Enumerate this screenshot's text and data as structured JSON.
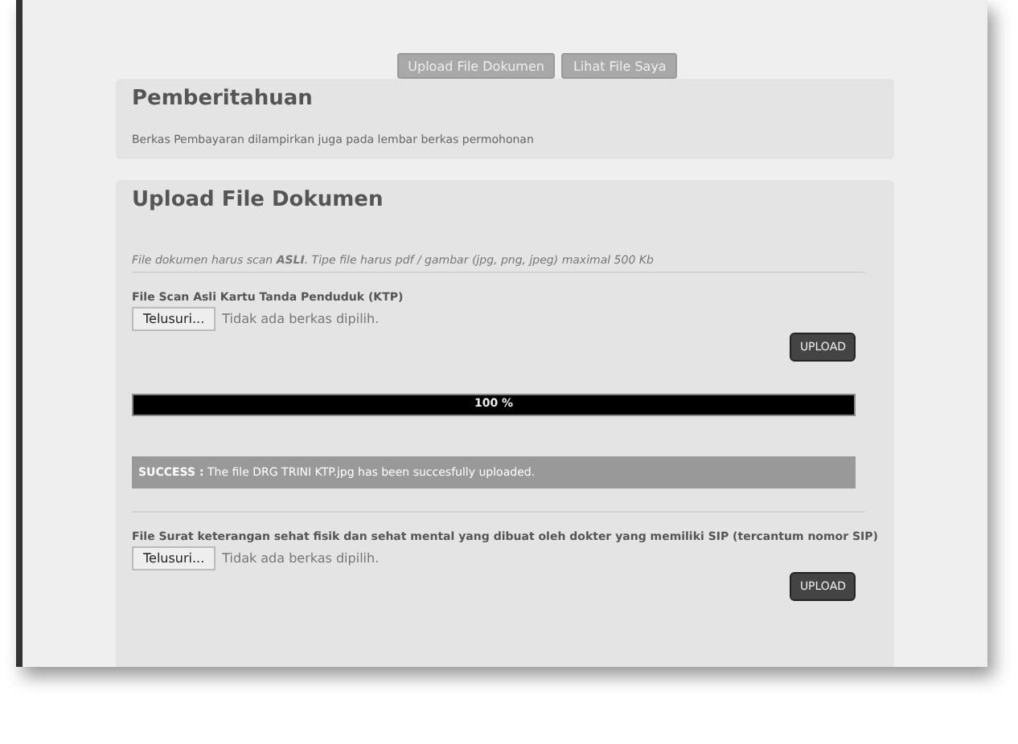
{
  "nav_buttons": [
    "Upload File Dokumen",
    "Lihat File Saya"
  ],
  "notice": {
    "title": "Pemberitahuan",
    "text": "Berkas Pembayaran dilampirkan juga pada lembar berkas permohonan"
  },
  "upload": {
    "title": "Upload File Dokumen",
    "note": "File dokumen harus scan **ASLI**. Tipe file harus pdf / gambar (jpg, png, jpeg) maximal 500 Kb",
    "fields": [
      {
        "label": "File Scan Asli Kartu Tanda Penduduk (KTP)",
        "browse": "Telusuri...",
        "file_status": "Tidak ada berkas dipilih.",
        "button": "UPLOAD",
        "progress": {
          "level": 1,
          "reading": "100 %"
        },
        "message": "**SUCCESS :** The file DRG TRINI KTP.jpg has been succesfully uploaded."
      },
      {
        "label": "File Surat keterangan sehat fisik dan sehat mental yang dibuat oleh dokter yang memiliki SIP (tercantum nomor SIP)",
        "browse": "Telusuri...",
        "file_status": "Tidak ada berkas dipilih.",
        "button": "UPLOAD"
      }
    ]
  }
}
